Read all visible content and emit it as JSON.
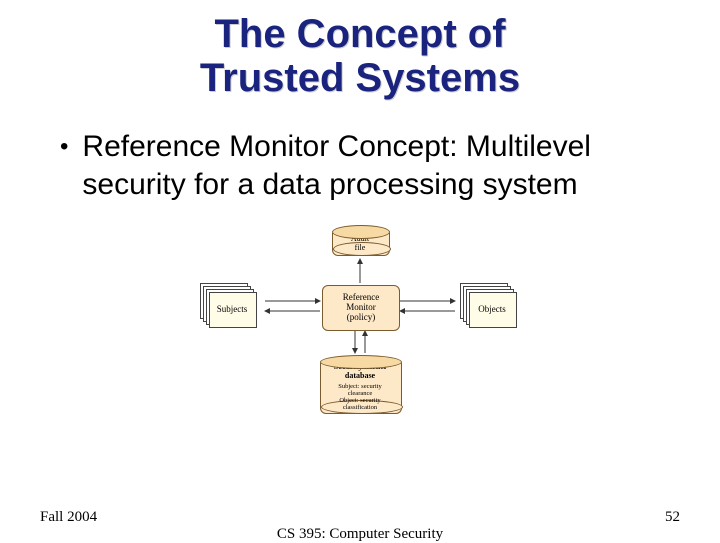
{
  "title_line1": "The Concept of",
  "title_line2": "Trusted Systems",
  "bullet_text": "Reference Monitor Concept: Multilevel security for a data processing system",
  "diagram": {
    "subjects": "Subjects",
    "objects": "Objects",
    "rm_line1": "Reference",
    "rm_line2": "Monitor",
    "rm_line3": "(policy)",
    "audit_line1": "Audit",
    "audit_line2": "file",
    "db_line1": "Security kernel",
    "db_line2": "database",
    "db_sub1": "Subject: security",
    "db_sub2": "clearance",
    "db_sub3": "Object: security",
    "db_sub4": "classification"
  },
  "footer": {
    "left": "Fall 2004",
    "center": "CS 395: Computer Security",
    "right": "52"
  }
}
